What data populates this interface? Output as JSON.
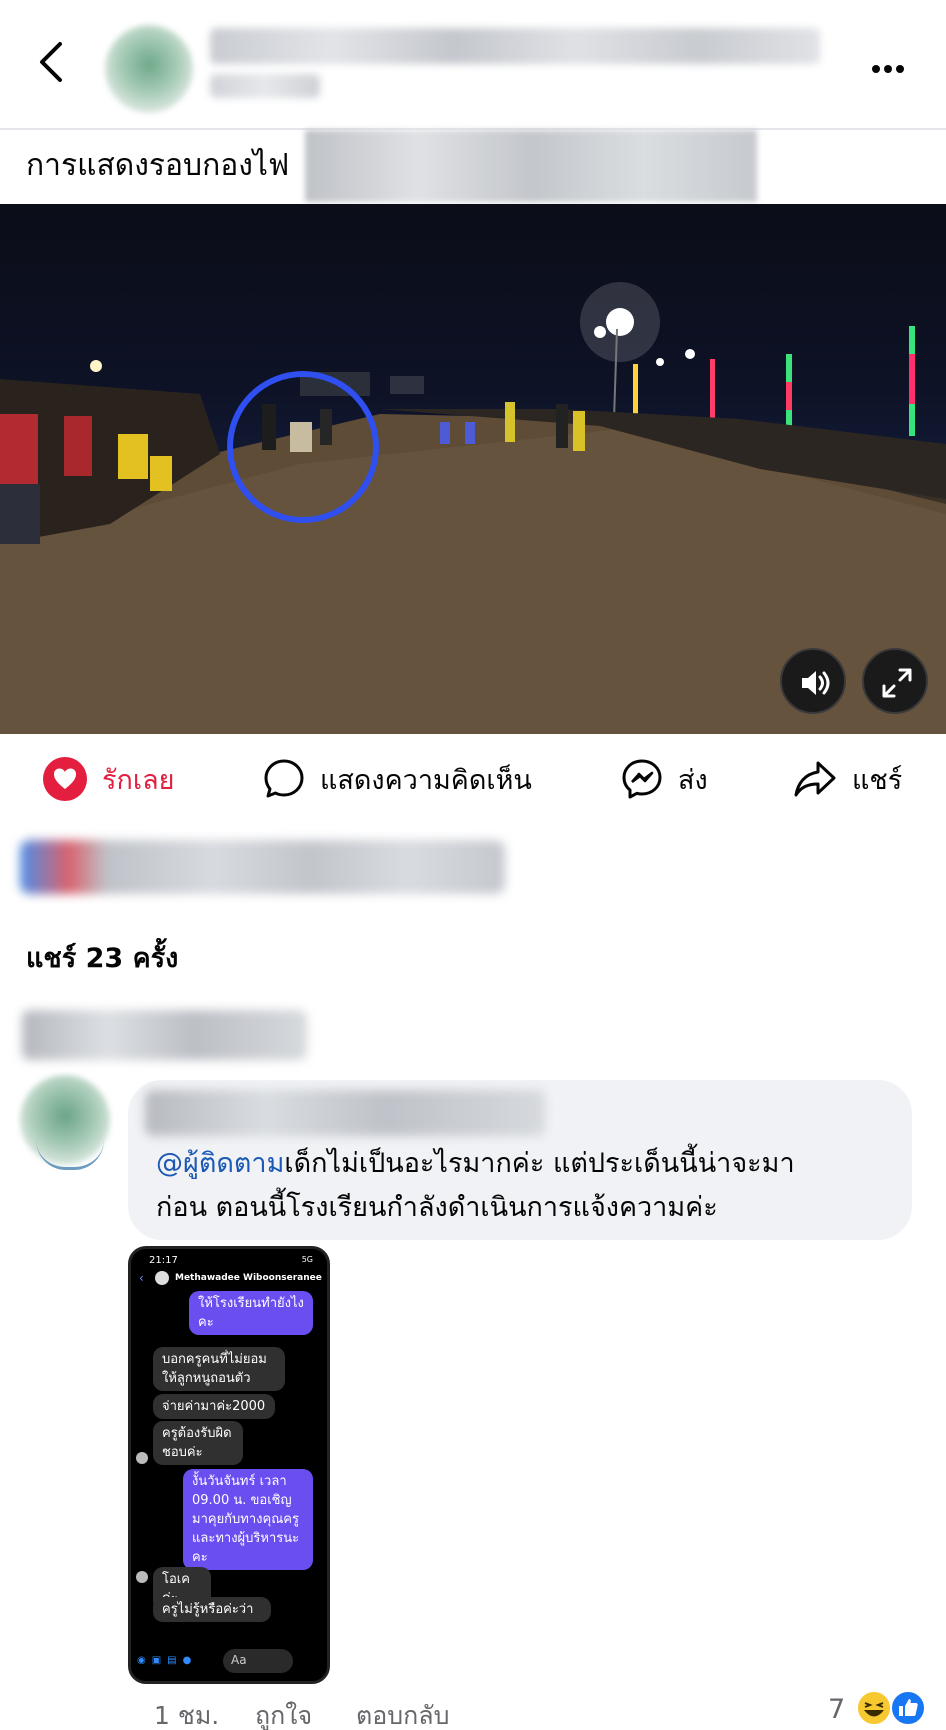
{
  "header": {
    "title": "",
    "subtitle": ""
  },
  "caption": {
    "text": "การแสดงรอบกองไฟ"
  },
  "actions": {
    "love": "รักเลย",
    "comment": "แสดงความคิดเห็น",
    "send": "ส่ง",
    "share": "แชร์"
  },
  "post": {
    "shares": "แชร์ 23 ครั้ง"
  },
  "comment": {
    "mention": "@ผู้ติดตาม",
    "text_line1": "เด็กไม่เป็นอะไรมากค่ะ แต่ประเด็นนี้น่าจะมา",
    "text_line2": "ก่อน  ตอนนี้โรงเรียนกำลังดำเนินการแจ้งความค่ะ",
    "time": "1 ชม.",
    "like": "ถูกใจ",
    "reply": "ตอบกลับ",
    "reaction_count": "7"
  },
  "attachment": {
    "time": "21:17",
    "status_right": "5G",
    "chat_name": "Methawadee Wiboonseranee",
    "messages": [
      {
        "dir": "out",
        "text": "ให้โรงเรียนทำยังไงคะ"
      },
      {
        "dir": "in",
        "text": "บอกครูคนที่ไม่ยอมให้ลูกหนูถอนตัว"
      },
      {
        "dir": "in",
        "text": "จ่ายค่ามาค่ะ2000"
      },
      {
        "dir": "in",
        "text": "ครูต้องรับผิดชอบค่ะ"
      },
      {
        "dir": "out",
        "text": "งั้นวันจันทร์ เวลา 09.00 น. ขอเชิญมาคุยกับทางคุณครูและทางผู้บริหารนะคะ"
      },
      {
        "dir": "in",
        "text": "โอเคค่ะ"
      },
      {
        "dir": "in",
        "text": "ครูไม่รู้หรือค่ะว่า"
      }
    ],
    "input_placeholder": "Aa"
  },
  "colors": {
    "love": "#e41e3f",
    "mention": "#1b59b4",
    "bubble": "#f0f2f5",
    "highlight_circle": "#2f4ff0",
    "messenger_out": "#6a4ef0"
  },
  "icons": [
    "back-arrow-icon",
    "more-icon",
    "volume-icon",
    "fullscreen-icon",
    "heart-icon",
    "comment-icon",
    "messenger-icon",
    "share-icon",
    "haha-emoji-icon",
    "like-emoji-icon"
  ]
}
